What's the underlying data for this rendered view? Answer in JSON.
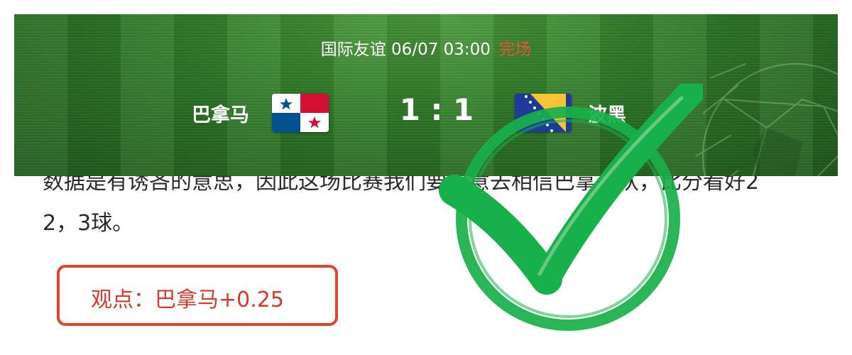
{
  "match": {
    "competition": "国际友谊",
    "datetime": "06/07 03:00",
    "status": "完场",
    "home_team": "巴拿马",
    "away_team": "波黑",
    "score": "1 : 1",
    "home_flag": "panama-flag-icon",
    "away_flag": "bosnia-flag-icon"
  },
  "article": {
    "line1": "数据是有诱吝的意思，因此这场比赛我们要愿意去相信巴拿马队，比分看好2",
    "line2": "2，3球。"
  },
  "opinion": {
    "label": "观点：巴拿马+0.25"
  },
  "colors": {
    "status": "#e8533a",
    "opinion_border": "#e2452e",
    "stamp": "#18b04a",
    "pitch": "#2f7a28"
  }
}
